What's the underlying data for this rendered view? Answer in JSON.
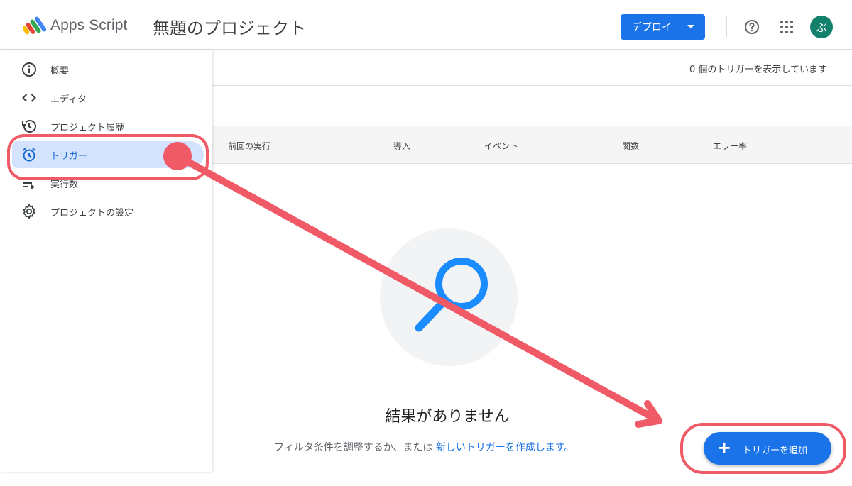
{
  "header": {
    "app_name": "Apps Script",
    "project_title": "無題のプロジェクト",
    "deploy_label": "デプロイ",
    "avatar_initial": "ぶ"
  },
  "sidebar": {
    "items": [
      {
        "label": "概要",
        "icon": "info-icon"
      },
      {
        "label": "エディタ",
        "icon": "code-icon"
      },
      {
        "label": "プロジェクト履歴",
        "icon": "history-icon"
      },
      {
        "label": "トリガー",
        "icon": "alarm-clock-icon",
        "active": true
      },
      {
        "label": "実行数",
        "icon": "executions-list-icon"
      },
      {
        "label": "プロジェクトの設定",
        "icon": "gear-icon"
      }
    ]
  },
  "main": {
    "trigger_count_text": "0 個のトリガーを表示しています",
    "columns": [
      "前回の実行",
      "導入",
      "イベント",
      "関数",
      "エラー率"
    ],
    "empty_title": "結果がありません",
    "empty_sub_prefix": "フィルタ条件を調整するか、または ",
    "empty_sub_link": "新しいトリガーを作成します。",
    "add_trigger_label": "トリガーを追加"
  },
  "colors": {
    "primary": "#1a73e8",
    "active_nav_bg": "#d3e3fd",
    "annotation_red": "#f05a66",
    "avatar_bg": "#12806a"
  }
}
